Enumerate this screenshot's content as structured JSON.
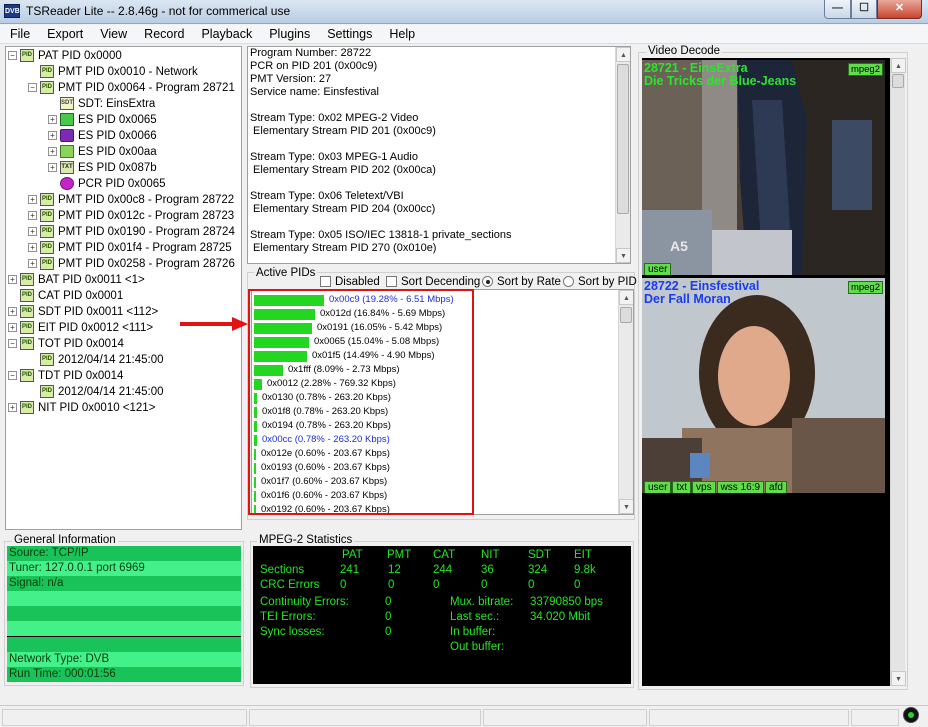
{
  "window": {
    "title": "TSReader Lite -- 2.8.46g - not for commerical use",
    "icon_text": "DVB",
    "minimize_glyph": "—",
    "maximize_glyph": "☐",
    "close_glyph": "✕"
  },
  "menu": [
    "File",
    "Export",
    "View",
    "Record",
    "Playback",
    "Plugins",
    "Settings",
    "Help"
  ],
  "tree": [
    {
      "label": "PAT PID 0x0000",
      "exp": "−",
      "icon": "pid-icon",
      "icon_text": "PID"
    },
    {
      "label": "PMT PID 0x0010 - Network",
      "exp": "",
      "icon": "pid-icon",
      "icon_text": "PID"
    },
    {
      "label": "PMT PID 0x0064 - Program 28721",
      "exp": "−",
      "icon": "pid-icon",
      "icon_text": "PID"
    },
    {
      "label": "SDT: EinsExtra",
      "exp": "",
      "icon": "sdt-icon",
      "icon_text": "SDT"
    },
    {
      "label": "ES PID 0x0065",
      "exp": "+",
      "icon": "video-icon",
      "icon_text": ""
    },
    {
      "label": "ES PID 0x0066",
      "exp": "+",
      "icon": "audio-icon",
      "icon_text": ""
    },
    {
      "label": "ES PID 0x00aa",
      "exp": "+",
      "icon": "teletext-icon",
      "icon_text": ""
    },
    {
      "label": "ES PID 0x087b",
      "exp": "+",
      "icon": "txt-icon",
      "icon_text": "TXT"
    },
    {
      "label": "PCR PID 0x0065",
      "exp": "",
      "icon": "pcr-icon",
      "icon_text": ""
    },
    {
      "label": "PMT PID 0x00c8 - Program 28722",
      "exp": "+",
      "icon": "pid-icon",
      "icon_text": "PID"
    },
    {
      "label": "PMT PID 0x012c - Program 28723",
      "exp": "+",
      "icon": "pid-icon",
      "icon_text": "PID"
    },
    {
      "label": "PMT PID 0x0190 - Program 28724",
      "exp": "+",
      "icon": "pid-icon",
      "icon_text": "PID"
    },
    {
      "label": "PMT PID 0x01f4 - Program 28725",
      "exp": "+",
      "icon": "pid-icon",
      "icon_text": "PID"
    },
    {
      "label": "PMT PID 0x0258 - Program 28726",
      "exp": "+",
      "icon": "pid-icon",
      "icon_text": "PID"
    },
    {
      "label": "BAT PID 0x0011 <1>",
      "exp": "+",
      "icon": "pid-icon",
      "icon_text": "PID"
    },
    {
      "label": "CAT PID 0x0001",
      "exp": "",
      "icon": "pid-icon",
      "icon_text": "PID"
    },
    {
      "label": "SDT PID 0x0011 <112>",
      "exp": "+",
      "icon": "pid-icon",
      "icon_text": "PID"
    },
    {
      "label": "EIT PID 0x0012 <111>",
      "exp": "+",
      "icon": "pid-icon",
      "icon_text": "PID"
    },
    {
      "label": "TOT PID 0x0014",
      "exp": "−",
      "icon": "pid-icon",
      "icon_text": "PID"
    },
    {
      "label": "2012/04/14 21:45:00",
      "exp": "",
      "icon": "pid-icon",
      "icon_text": "PID"
    },
    {
      "label": "TDT PID 0x0014",
      "exp": "−",
      "icon": "pid-icon",
      "icon_text": "PID"
    },
    {
      "label": "2012/04/14 21:45:00",
      "exp": "",
      "icon": "pid-icon",
      "icon_text": "PID"
    },
    {
      "label": "NIT PID 0x0010 <121>",
      "exp": "+",
      "icon": "pid-icon",
      "icon_text": "PID"
    }
  ],
  "details_lines": [
    "Program Number: 28722",
    "PCR on PID 201 (0x00c9)",
    "PMT Version: 27",
    "Service name: Einsfestival",
    "",
    "Stream Type: 0x02 MPEG-2 Video",
    " Elementary Stream PID 201 (0x00c9)",
    "",
    "Stream Type: 0x03 MPEG-1 Audio",
    " Elementary Stream PID 202 (0x00ca)",
    "",
    "Stream Type: 0x06 Teletext/VBI",
    " Elementary Stream PID 204 (0x00cc)",
    "",
    "Stream Type: 0x05 ISO/IEC 13818-1 private_sections",
    " Elementary Stream PID 270 (0x010e)"
  ],
  "active_pids": {
    "group_label": "Active PIDs",
    "disabled_label": "Disabled",
    "sort_descending_label": "Sort Decending",
    "sort_by_rate_label": "Sort by Rate",
    "sort_by_pid_label": "Sort by PID",
    "sort_by_rate_selected": true,
    "disabled_checked": false,
    "sort_descending_checked": false,
    "rows": [
      {
        "label": "0x00c9 (19.28% - 6.51 Mbps)",
        "percent": 19.28,
        "highlight": true
      },
      {
        "label": "0x012d (16.84% - 5.69 Mbps)",
        "percent": 16.84,
        "highlight": false
      },
      {
        "label": "0x0191 (16.05% - 5.42 Mbps)",
        "percent": 16.05,
        "highlight": false
      },
      {
        "label": "0x0065 (15.04% - 5.08 Mbps)",
        "percent": 15.04,
        "highlight": false
      },
      {
        "label": "0x01f5 (14.49% - 4.90 Mbps)",
        "percent": 14.49,
        "highlight": false
      },
      {
        "label": "0x1fff (8.09% - 2.73 Mbps)",
        "percent": 8.09,
        "highlight": false
      },
      {
        "label": "0x0012 (2.28% - 769.32 Kbps)",
        "percent": 2.28,
        "highlight": false
      },
      {
        "label": "0x0130 (0.78% - 263.20 Kbps)",
        "percent": 0.78,
        "highlight": false
      },
      {
        "label": "0x01f8 (0.78% - 263.20 Kbps)",
        "percent": 0.78,
        "highlight": false
      },
      {
        "label": "0x0194 (0.78% - 263.20 Kbps)",
        "percent": 0.78,
        "highlight": false
      },
      {
        "label": "0x00cc (0.78% - 263.20 Kbps)",
        "percent": 0.78,
        "highlight": true
      },
      {
        "label": "0x012e (0.60% - 203.67 Kbps)",
        "percent": 0.6,
        "highlight": false
      },
      {
        "label": "0x0193 (0.60% - 203.67 Kbps)",
        "percent": 0.6,
        "highlight": false
      },
      {
        "label": "0x01f7 (0.60% - 203.67 Kbps)",
        "percent": 0.6,
        "highlight": false
      },
      {
        "label": "0x01f6 (0.60% - 203.67 Kbps)",
        "percent": 0.6,
        "highlight": false
      },
      {
        "label": "0x0192 (0.60% - 203.67 Kbps)",
        "percent": 0.6,
        "highlight": false
      }
    ]
  },
  "general_info": {
    "label": "General Information",
    "rows": [
      "Source: TCP/IP",
      "Tuner: 127.0.0.1 port 6969",
      "Signal: n/a",
      "",
      "",
      "",
      "",
      "Network Type: DVB",
      "Run Time: 000:01:56"
    ]
  },
  "mpeg2_stats": {
    "label": "MPEG-2 Statistics",
    "columns": [
      "PAT",
      "PMT",
      "CAT",
      "NIT",
      "SDT",
      "EIT"
    ],
    "sections_label": "Sections",
    "sections": [
      "241",
      "12",
      "244",
      "36",
      "324",
      "9.8k"
    ],
    "crc_label": "CRC Errors",
    "crc": [
      "0",
      "0",
      "0",
      "0",
      "0",
      "0"
    ],
    "continuity_label": "Continuity Errors:",
    "continuity": "0",
    "tei_label": "TEI Errors:",
    "tei": "0",
    "sync_label": "Sync losses:",
    "sync": "0",
    "mux_label": "Mux. bitrate:",
    "mux": "33790850 bps",
    "last_sec_label": "Last sec.:",
    "last_sec": "34.020 Mbit",
    "in_buffer_label": "In buffer:",
    "out_buffer_label": "Out buffer:"
  },
  "video_decode": {
    "label": "Video Decode",
    "frame1": {
      "title_line1": "28721 - EinsExtra",
      "title_line2": "Die Tricks der Blue-Jeans",
      "codec": "mpeg2",
      "chips": [
        "user"
      ],
      "title_color": "#2de42d"
    },
    "frame2": {
      "title_line1": "28722 - Einsfestival",
      "title_line2": "Der Fall Moran",
      "codec": "mpeg2",
      "chips": [
        "user",
        "txt",
        "vps",
        "wss 16:9",
        "afd"
      ],
      "title_color": "#1a3cf0"
    },
    "watermark": "A5"
  }
}
